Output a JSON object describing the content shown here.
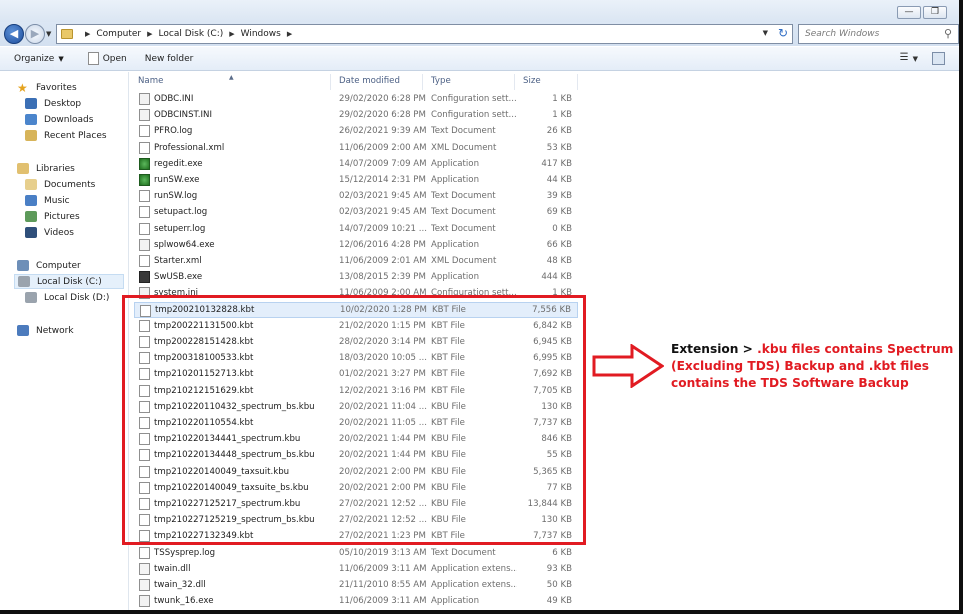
{
  "window": {
    "controls": [
      "—",
      "❐"
    ]
  },
  "address": {
    "crumbs": [
      "Computer",
      "Local Disk (C:)",
      "Windows"
    ],
    "search_placeholder": "Search Windows"
  },
  "toolbar": {
    "organize": "Organize",
    "open": "Open",
    "new_folder": "New folder"
  },
  "nav": {
    "favorites": {
      "label": "Favorites",
      "items": [
        "Desktop",
        "Downloads",
        "Recent Places"
      ]
    },
    "libraries": {
      "label": "Libraries",
      "items": [
        "Documents",
        "Music",
        "Pictures",
        "Videos"
      ]
    },
    "computer": {
      "label": "Computer",
      "items": [
        "Local Disk (C:)",
        "Local Disk (D:)"
      ],
      "selected": "Local Disk (C:)"
    },
    "network": {
      "label": "Network"
    }
  },
  "columns": {
    "name": "Name",
    "date": "Date modified",
    "type": "Type",
    "size": "Size"
  },
  "files": [
    {
      "name": "ODBC.INI",
      "date": "29/02/2020 6:28 PM",
      "type": "Configuration sett...",
      "size": "1 KB",
      "icon": "cfg"
    },
    {
      "name": "ODBCINST.INI",
      "date": "29/02/2020 6:28 PM",
      "type": "Configuration sett...",
      "size": "1 KB",
      "icon": "cfg"
    },
    {
      "name": "PFRO.log",
      "date": "26/02/2021 9:39 AM",
      "type": "Text Document",
      "size": "26 KB",
      "icon": "doc"
    },
    {
      "name": "Professional.xml",
      "date": "11/06/2009 2:00 AM",
      "type": "XML Document",
      "size": "53 KB",
      "icon": "doc"
    },
    {
      "name": "regedit.exe",
      "date": "14/07/2009 7:09 AM",
      "type": "Application",
      "size": "417 KB",
      "icon": "reg"
    },
    {
      "name": "runSW.exe",
      "date": "15/12/2014 2:31 PM",
      "type": "Application",
      "size": "44 KB",
      "icon": "reg"
    },
    {
      "name": "runSW.log",
      "date": "02/03/2021 9:45 AM",
      "type": "Text Document",
      "size": "39 KB",
      "icon": "doc"
    },
    {
      "name": "setupact.log",
      "date": "02/03/2021 9:45 AM",
      "type": "Text Document",
      "size": "69 KB",
      "icon": "doc"
    },
    {
      "name": "setuperr.log",
      "date": "14/07/2009 10:21 ...",
      "type": "Text Document",
      "size": "0 KB",
      "icon": "doc"
    },
    {
      "name": "splwow64.exe",
      "date": "12/06/2016 4:28 PM",
      "type": "Application",
      "size": "66 KB",
      "icon": "cfg"
    },
    {
      "name": "Starter.xml",
      "date": "11/06/2009 2:01 AM",
      "type": "XML Document",
      "size": "48 KB",
      "icon": "doc"
    },
    {
      "name": "SwUSB.exe",
      "date": "13/08/2015 2:39 PM",
      "type": "Application",
      "size": "444 KB",
      "icon": "app"
    },
    {
      "name": "system.ini",
      "date": "11/06/2009 2:00 AM",
      "type": "Configuration sett...",
      "size": "1 KB",
      "icon": "cfg"
    },
    {
      "name": "tmp200210132828.kbt",
      "date": "10/02/2020 1:28 PM",
      "type": "KBT File",
      "size": "7,556 KB",
      "icon": "doc",
      "selected": true
    },
    {
      "name": "tmp200221131500.kbt",
      "date": "21/02/2020 1:15 PM",
      "type": "KBT File",
      "size": "6,842 KB",
      "icon": "doc"
    },
    {
      "name": "tmp200228151428.kbt",
      "date": "28/02/2020 3:14 PM",
      "type": "KBT File",
      "size": "6,945 KB",
      "icon": "doc"
    },
    {
      "name": "tmp200318100533.kbt",
      "date": "18/03/2020 10:05 ...",
      "type": "KBT File",
      "size": "6,995 KB",
      "icon": "doc"
    },
    {
      "name": "tmp210201152713.kbt",
      "date": "01/02/2021 3:27 PM",
      "type": "KBT File",
      "size": "7,692 KB",
      "icon": "doc"
    },
    {
      "name": "tmp210212151629.kbt",
      "date": "12/02/2021 3:16 PM",
      "type": "KBT File",
      "size": "7,705 KB",
      "icon": "doc"
    },
    {
      "name": "tmp210220110432_spectrum_bs.kbu",
      "date": "20/02/2021 11:04 ...",
      "type": "KBU File",
      "size": "130 KB",
      "icon": "doc"
    },
    {
      "name": "tmp210220110554.kbt",
      "date": "20/02/2021 11:05 ...",
      "type": "KBT File",
      "size": "7,737 KB",
      "icon": "doc"
    },
    {
      "name": "tmp210220134441_spectrum.kbu",
      "date": "20/02/2021 1:44 PM",
      "type": "KBU File",
      "size": "846 KB",
      "icon": "doc"
    },
    {
      "name": "tmp210220134448_spectrum_bs.kbu",
      "date": "20/02/2021 1:44 PM",
      "type": "KBU File",
      "size": "55 KB",
      "icon": "doc"
    },
    {
      "name": "tmp210220140049_taxsuit.kbu",
      "date": "20/02/2021 2:00 PM",
      "type": "KBU File",
      "size": "5,365 KB",
      "icon": "doc"
    },
    {
      "name": "tmp210220140049_taxsuite_bs.kbu",
      "date": "20/02/2021 2:00 PM",
      "type": "KBU File",
      "size": "77 KB",
      "icon": "doc"
    },
    {
      "name": "tmp210227125217_spectrum.kbu",
      "date": "27/02/2021 12:52 ...",
      "type": "KBU File",
      "size": "13,844 KB",
      "icon": "doc"
    },
    {
      "name": "tmp210227125219_spectrum_bs.kbu",
      "date": "27/02/2021 12:52 ...",
      "type": "KBU File",
      "size": "130 KB",
      "icon": "doc"
    },
    {
      "name": "tmp210227132349.kbt",
      "date": "27/02/2021 1:23 PM",
      "type": "KBT File",
      "size": "7,737 KB",
      "icon": "doc"
    },
    {
      "name": "TSSysprep.log",
      "date": "05/10/2019 3:13 AM",
      "type": "Text Document",
      "size": "6 KB",
      "icon": "doc"
    },
    {
      "name": "twain.dll",
      "date": "11/06/2009 3:11 AM",
      "type": "Application extens...",
      "size": "93 KB",
      "icon": "dll"
    },
    {
      "name": "twain_32.dll",
      "date": "21/11/2010 8:55 AM",
      "type": "Application extens...",
      "size": "50 KB",
      "icon": "dll"
    },
    {
      "name": "twunk_16.exe",
      "date": "11/06/2009 3:11 AM",
      "type": "Application",
      "size": "49 KB",
      "icon": "cfg"
    }
  ],
  "annotation": {
    "lead": "Extension > ",
    "text": ".kbu files contains Spectrum (Excluding TDS) Backup and .kbt files contains the TDS Software Backup",
    "color": "#e11b22"
  }
}
